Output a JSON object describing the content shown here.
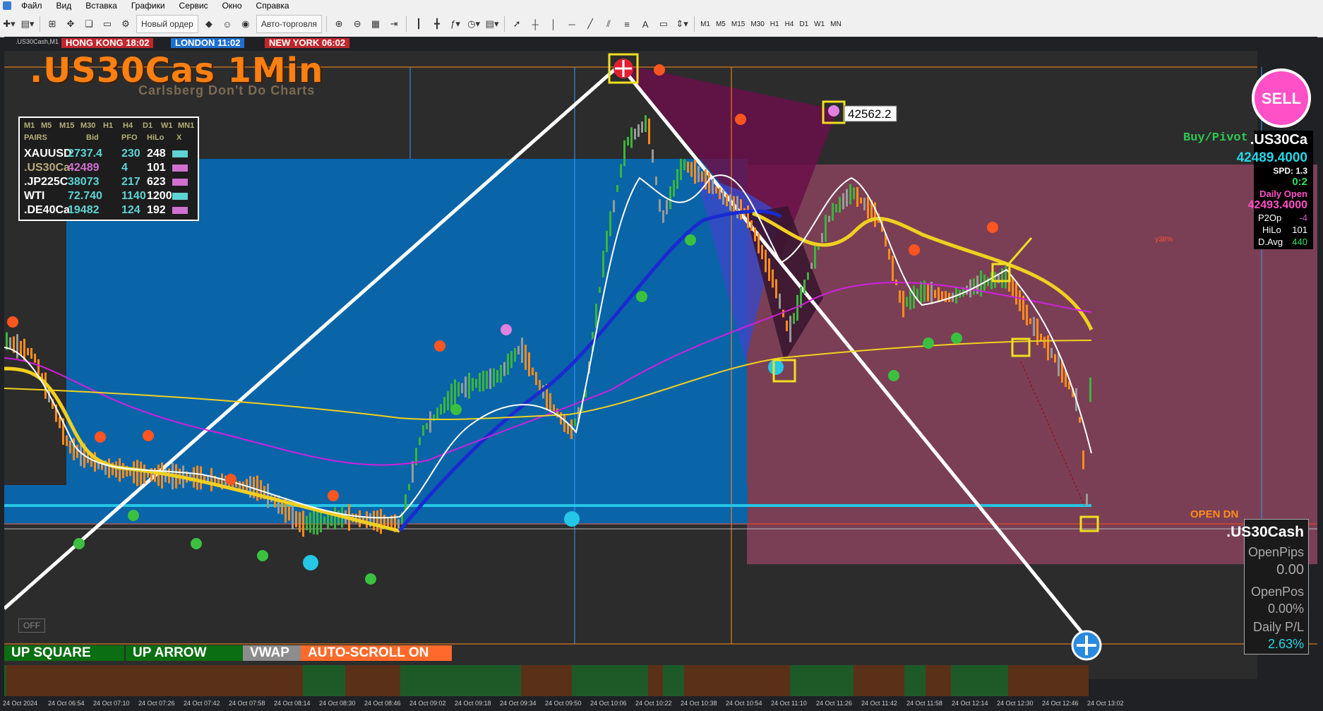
{
  "menu": [
    "Файл",
    "Вид",
    "Вставка",
    "Графики",
    "Сервис",
    "Окно",
    "Справка"
  ],
  "toolbar": {
    "new_order": "Новый ордер",
    "auto_trading": "Авто-торговля",
    "timeframes": [
      "M1",
      "M5",
      "M15",
      "M30",
      "H1",
      "H4",
      "D1",
      "W1",
      "MN"
    ]
  },
  "chart": {
    "symbol_label": ".US30Cash,M1",
    "sessions": [
      {
        "label": "HONG KONG 18:02",
        "color": "#c0272d"
      },
      {
        "label": "LONDON 11:02",
        "color": "#1f6fd0"
      },
      {
        "label": "NEW YORK 06:02",
        "color": "#c0272d"
      }
    ],
    "title": ".US30Cas 1Min",
    "subtitle": "Carlsberg Don't Do Charts",
    "price_tag": "42562.2",
    "y38_label": "y38%",
    "open_dn_label": "OPEN DN",
    "off_button": "OFF",
    "bottom_buttons": [
      {
        "label": "UP SQUARE",
        "color": "#0b6e12"
      },
      {
        "label": "UP ARROW",
        "color": "#0b6e12"
      },
      {
        "label": "VWAP",
        "color": "#8c8c8c"
      },
      {
        "label": "AUTO-SCROLL ON",
        "color": "#ff6a2a"
      }
    ]
  },
  "market_table": {
    "tf_header": [
      "M1",
      "M5",
      "M15",
      "M30",
      "H1",
      "H4",
      "D1",
      "W1",
      "MN1"
    ],
    "columns": [
      "PAIRS",
      "Bid",
      "PFO",
      "HiLo",
      "X"
    ],
    "rows": [
      {
        "pair": "XAUUSD",
        "bid": "2737.4",
        "pfo": "230",
        "hilo": "248",
        "pair_color": "#ffffff",
        "bid_color": "#5fd3d3",
        "x_color": "#5fd3d3"
      },
      {
        "pair": ".US30Ca",
        "bid": "42489",
        "pfo": "4",
        "hilo": "101",
        "pair_color": "#b8a87a",
        "bid_color": "#d070d0",
        "x_color": "#d070d0"
      },
      {
        "pair": ".JP225C",
        "bid": "38073",
        "pfo": "217",
        "hilo": "623",
        "pair_color": "#ffffff",
        "bid_color": "#5fd3d3",
        "x_color": "#d070d0"
      },
      {
        "pair": "WTI",
        "bid": "72.740",
        "pfo": "1140",
        "hilo": "1200",
        "pair_color": "#ffffff",
        "bid_color": "#5fd3d3",
        "x_color": "#5fd3d3"
      },
      {
        "pair": ".DE40Ca",
        "bid": "19482",
        "pfo": "124",
        "hilo": "192",
        "pair_color": "#ffffff",
        "bid_color": "#5fd3d3",
        "x_color": "#d070d0"
      }
    ]
  },
  "right_panel": {
    "sell_label": "SELL",
    "buy_pivot": "Buy/Pivot",
    "symbol": ".US30Ca",
    "price": "42489.4000",
    "spd": "SPD: 1.3",
    "ratio": "0:2",
    "daily_open_label": "Daily Open",
    "daily_open": "42493.4000",
    "p2op_label": "P2Op",
    "p2op": "-4",
    "hilo_label": "HiLo",
    "hilo": "101",
    "davg_label": "D.Avg",
    "davg": "440"
  },
  "pl_panel": {
    "symbol": ".US30Cash",
    "open_pips_label": "OpenPips",
    "open_pips": "0.00",
    "open_pos_label": "OpenPos",
    "open_pos": "0.00%",
    "daily_pl_label": "Daily P/L",
    "daily_pl": "2.63%"
  },
  "x_axis": [
    "24 Oct 2024",
    "24 Oct 06:54",
    "24 Oct 07:10",
    "24 Oct 07:26",
    "24 Oct 07:42",
    "24 Oct 07:58",
    "24 Oct 08:14",
    "24 Oct 08:30",
    "24 Oct 08:46",
    "24 Oct 09:02",
    "24 Oct 09:18",
    "24 Oct 09:34",
    "24 Oct 09:50",
    "24 Oct 10:06",
    "24 Oct 10:22",
    "24 Oct 10:38",
    "24 Oct 10:54",
    "24 Oct 11:10",
    "24 Oct 11:26",
    "24 Oct 11:42",
    "24 Oct 11:58",
    "24 Oct 12:14",
    "24 Oct 12:30",
    "24 Oct 12:46",
    "24 Oct 13:02"
  ],
  "colors": {
    "up": "#3cb43c",
    "down": "#ff8c1a",
    "neutral": "#9a9a9a",
    "box_blue": "#0a64a8",
    "box_pink": "#7a3f55",
    "ema_yellow": "#f0d020",
    "ema_blue": "#1a2ad0",
    "ema_magenta": "#d020e0"
  }
}
